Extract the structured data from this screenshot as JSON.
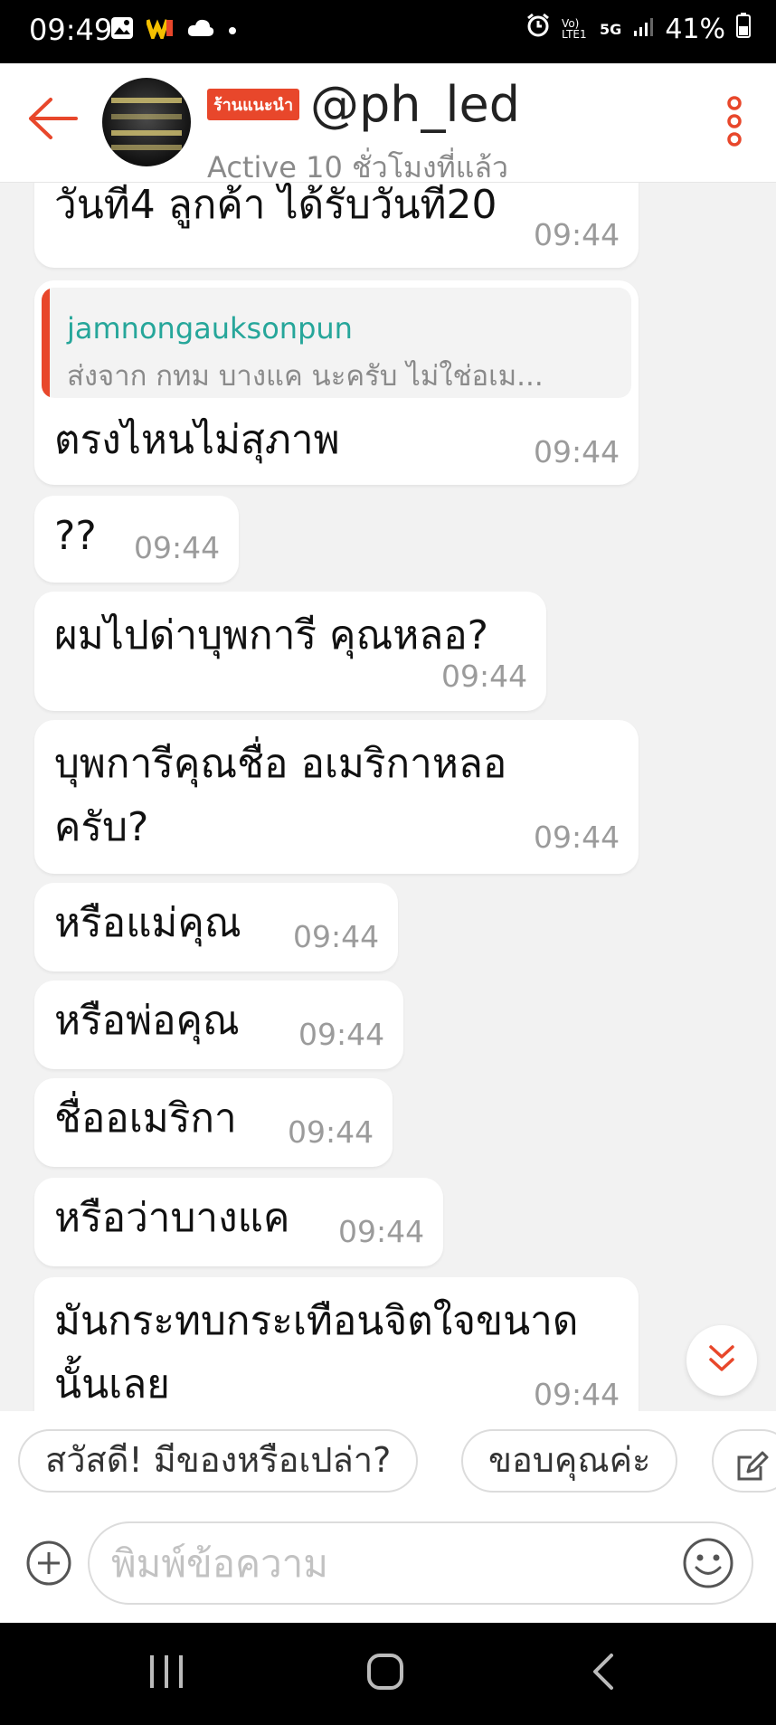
{
  "status_bar": {
    "time": "09:49",
    "battery": "41%",
    "network": "5G",
    "carrier": "Vo) LTE1"
  },
  "header": {
    "badge": "ร้านแนะนำ",
    "shop_name": "@ph_led",
    "active_status": "Active 10 ชั่วโมงที่แล้ว"
  },
  "messages": [
    {
      "text": "วันที่4 ลูกค้า ได้รับวันที่20",
      "time": "09:44"
    },
    {
      "quote_name": "jamnongauksonpun",
      "quote_text": "ส่งจาก กทม บางแค นะครับ ไม่ใช่อเม...",
      "text": "ตรงไหนไม่สุภาพ",
      "time": "09:44"
    },
    {
      "text": "??",
      "time": "09:44"
    },
    {
      "text": "ผมไปด่าบุพการี คุณหลอ?",
      "time": "09:44"
    },
    {
      "line1": "บุพการีคุณชื่อ อเมริกาหลอ",
      "line2": "ครับ?",
      "time": "09:44"
    },
    {
      "text": "หรือแม่คุณ",
      "time": "09:44"
    },
    {
      "text": "หรือพ่อคุณ",
      "time": "09:44"
    },
    {
      "text": "ชื่ออเมริกา",
      "time": "09:44"
    },
    {
      "text": "หรือว่าบางแค",
      "time": "09:44"
    },
    {
      "line1": "มันกระทบกระเทือนจิตใจขนาด",
      "line2": "นั้นเลย",
      "time": "09:44"
    }
  ],
  "quick_replies": [
    "สวัสดี! มีของหรือเปล่า?",
    "ขอบคุณค่ะ"
  ],
  "input": {
    "placeholder": "พิมพ์ข้อความ",
    "value": ""
  },
  "colors": {
    "accent": "#e8472b",
    "quote_name": "#26a69a"
  }
}
